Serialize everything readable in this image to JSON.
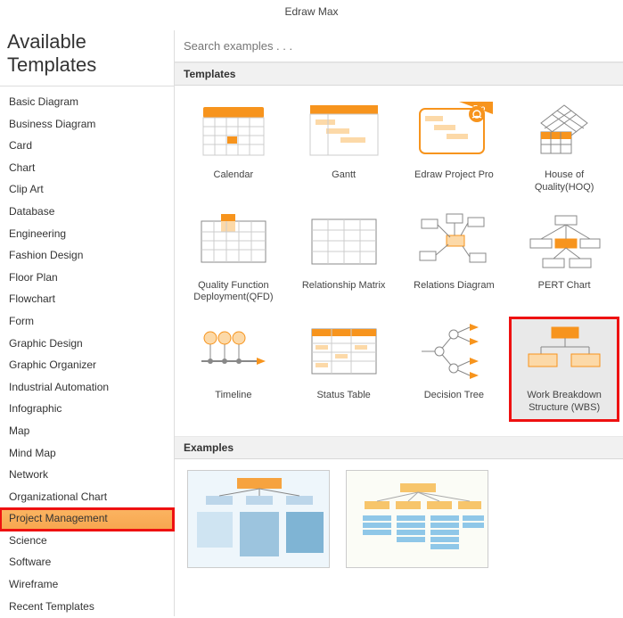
{
  "app_title": "Edraw Max",
  "left_header": "Available Templates",
  "search": {
    "placeholder": "Search examples . . ."
  },
  "categories": [
    "Basic Diagram",
    "Business Diagram",
    "Card",
    "Chart",
    "Clip Art",
    "Database",
    "Engineering",
    "Fashion Design",
    "Floor Plan",
    "Flowchart",
    "Form",
    "Graphic Design",
    "Graphic Organizer",
    "Industrial Automation",
    "Infographic",
    "Map",
    "Mind Map",
    "Network",
    "Organizational Chart",
    "Project Management",
    "Science",
    "Software",
    "Wireframe",
    "Recent Templates"
  ],
  "selected_category_index": 19,
  "sections": {
    "templates": "Templates",
    "examples": "Examples"
  },
  "templates": [
    {
      "label": "Calendar"
    },
    {
      "label": "Gantt"
    },
    {
      "label": "Edraw Project Pro"
    },
    {
      "label": "House of Quality(HOQ)"
    },
    {
      "label": "Quality Function Deployment(QFD)"
    },
    {
      "label": "Relationship Matrix"
    },
    {
      "label": "Relations Diagram"
    },
    {
      "label": "PERT Chart"
    },
    {
      "label": "Timeline"
    },
    {
      "label": "Status Table"
    },
    {
      "label": "Decision Tree"
    },
    {
      "label": "Work Breakdown Structure (WBS)"
    }
  ],
  "selected_template_index": 11,
  "colors": {
    "accent": "#f7941d",
    "accent_light": "#fcd9a8",
    "line": "#888"
  }
}
